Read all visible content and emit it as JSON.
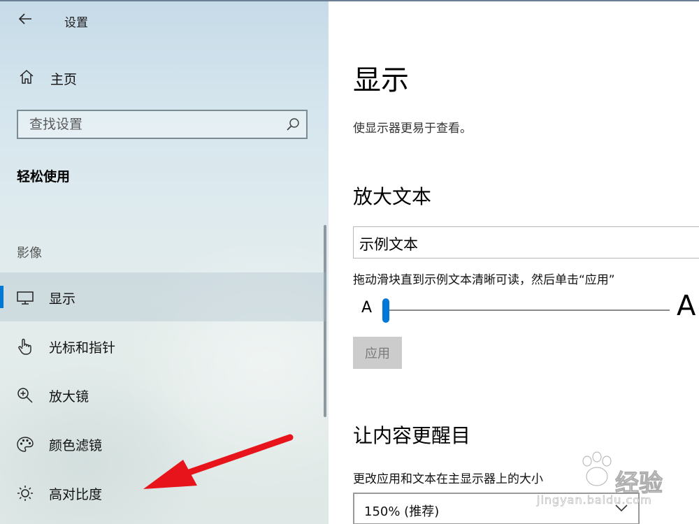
{
  "window": {
    "title": "设置"
  },
  "sidebar": {
    "home_label": "主页",
    "search_placeholder": "查找设置",
    "section_title": "轻松使用",
    "group_label": "影像",
    "items": [
      {
        "label": "显示",
        "icon": "monitor-icon",
        "selected": true
      },
      {
        "label": "光标和指针",
        "icon": "pointer-hand-icon",
        "selected": false
      },
      {
        "label": "放大镜",
        "icon": "magnifier-plus-icon",
        "selected": false
      },
      {
        "label": "颜色滤镜",
        "icon": "palette-icon",
        "selected": false
      },
      {
        "label": "高对比度",
        "icon": "brightness-icon",
        "selected": false
      }
    ]
  },
  "main": {
    "title": "显示",
    "description": "使显示器更易于查看。",
    "enlarge_text": {
      "heading": "放大文本",
      "sample_text": "示例文本",
      "hint": "拖动滑块直到示例文本清晰可读，然后单击“应用”",
      "slider_min_label": "A",
      "slider_max_label": "A",
      "slider_value": 0,
      "apply_label": "应用"
    },
    "make_bigger": {
      "heading": "让内容更醒目",
      "size_label": "更改应用和文本在主显示器上的大小",
      "size_value": "150% (推荐)"
    }
  },
  "watermark": {
    "text": "经验",
    "url": "jingyan.baidu.com"
  },
  "colors": {
    "accent": "#0078d7",
    "annotation_arrow": "#e8141b"
  }
}
